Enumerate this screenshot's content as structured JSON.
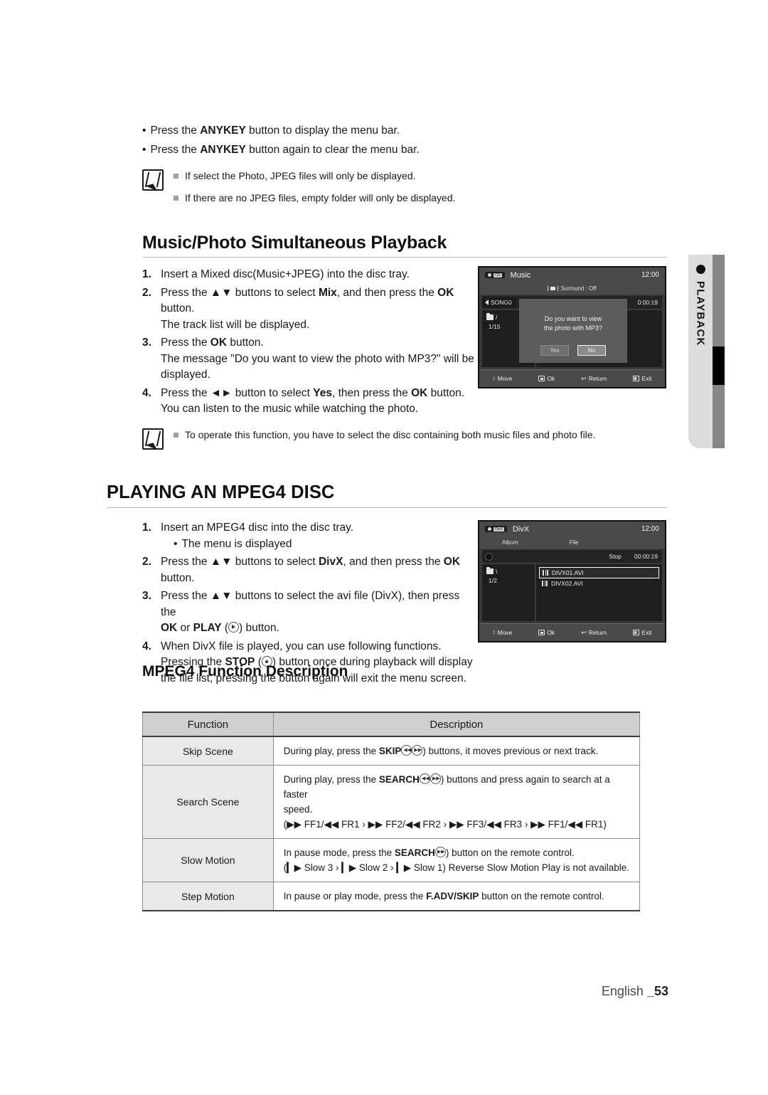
{
  "top_bullets": [
    {
      "pre": "Press the ",
      "bold": "ANYKEY",
      "post": " button to display the menu bar."
    },
    {
      "pre": "Press the ",
      "bold": "ANYKEY",
      "post": " button again to clear the menu bar."
    }
  ],
  "note1": {
    "items": [
      "If select the Photo, JPEG files will only be displayed.",
      "If there are no JPEG files, empty folder will only be displayed."
    ]
  },
  "section1": {
    "heading": "Music/Photo Simultaneous Playback",
    "steps": [
      {
        "num": "1.",
        "lines": [
          "Insert a Mixed disc(Music+JPEG) into the disc tray."
        ]
      },
      {
        "num": "2.",
        "lines": [
          "Press the ▲▼ buttons to select Mix, and then press the OK",
          "button.",
          "The track list will be displayed."
        ]
      },
      {
        "num": "3.",
        "lines": [
          "Press the OK button.",
          "The message \"Do you want to view the photo with MP3?\" will be",
          "displayed."
        ]
      },
      {
        "num": "4.",
        "lines": [
          "Press the ◄► button to select Yes, then press the OK button.",
          "You can listen to the music while watching the photo."
        ]
      }
    ]
  },
  "note2": {
    "items": [
      "To operate this function, you have to select the disc containing both music files and photo file."
    ]
  },
  "section2": {
    "heading": "PLAYING AN MPEG4 DISC",
    "steps": [
      {
        "num": "1.",
        "lines": [
          "Insert an MPEG4 disc into the disc tray."
        ],
        "sub": "The menu is displayed"
      },
      {
        "num": "2.",
        "lines": [
          "Press the ▲▼ buttons to select DivX, and then press the OK button."
        ]
      },
      {
        "num": "3.",
        "lines": [
          "Press the ▲▼ buttons to select the avi file (DivX), then press the",
          "OK or PLAY ( ) button."
        ]
      },
      {
        "num": "4.",
        "lines": [
          "When DivX file is played, you can use following functions.",
          "Pressing the STOP ( ) button once during playback will display",
          "the file list, pressing the button again will exit the menu screen."
        ]
      }
    ]
  },
  "screen_music": {
    "disc_label": "CD",
    "title": "Music",
    "clock": "12:00",
    "surround": "Surround : Off",
    "now_playing": "SONG0",
    "elapsed": "0:00:19",
    "folder": "/",
    "folder_count": "1/15",
    "dialog": {
      "message_line1": "Do you want to view",
      "message_line2": "the photo with MP3?",
      "yes": "Yes",
      "no": "No"
    },
    "bottom": [
      {
        "icon": "move-icon",
        "label": "Move"
      },
      {
        "icon": "ok-icon",
        "label": "Ok"
      },
      {
        "icon": "return-icon",
        "label": "Return"
      },
      {
        "icon": "exit-icon",
        "label": "Exit"
      }
    ]
  },
  "screen_divx": {
    "disc_label": "DivX",
    "title": "DivX",
    "clock": "12:00",
    "col_album": "Album",
    "col_file": "File",
    "status": "Stop",
    "elapsed": "00:00:19",
    "folder": "\\",
    "folder_count": "1/2",
    "files": [
      {
        "name": "DIVX01.AVI",
        "selected": true
      },
      {
        "name": "DIVX02.AVI",
        "selected": false
      }
    ],
    "bottom": [
      {
        "icon": "move-icon",
        "label": "Move"
      },
      {
        "icon": "ok-icon",
        "label": "Ok"
      },
      {
        "icon": "return-icon",
        "label": "Return"
      },
      {
        "icon": "exit-icon",
        "label": "Exit"
      }
    ]
  },
  "side_tab": {
    "label": "PLAYBACK"
  },
  "table": {
    "heading": "MPEG4 Function Description",
    "headers": [
      "Function",
      "Description"
    ],
    "rows": [
      {
        "function": "Skip Scene",
        "desc_pre": "During play, press the ",
        "desc_bold": "SKIP",
        "desc_post": ") buttons, it moves previous or next track.",
        "line2": "",
        "line3": ""
      },
      {
        "function": "Search Scene",
        "desc_pre": "During play, press the ",
        "desc_bold": "SEARCH",
        "desc_post": ") buttons and press again to search at a faster",
        "line2": "speed.",
        "line3": "(▶▶ FF1/◀◀ FR1 › ▶▶ FF2/◀◀ FR2 › ▶▶ FF3/◀◀ FR3 › ▶▶ FF1/◀◀ FR1)"
      },
      {
        "function": "Slow Motion",
        "desc_pre": "In pause mode, press the ",
        "desc_bold": "SEARCH",
        "desc_post": ") button on the remote control.",
        "line2": "(▎▶ Slow 3 › ▎▶ Slow 2 › ▎▶ Slow 1) Reverse Slow Motion Play is not available.",
        "line3": ""
      },
      {
        "function": "Step Motion",
        "desc_pre": "In pause or play mode, press the ",
        "desc_bold": "F.ADV/SKIP",
        "desc_post": " button on the remote control.",
        "line2": "",
        "line3": ""
      }
    ]
  },
  "footer": {
    "language": "English ",
    "page": "_53"
  }
}
